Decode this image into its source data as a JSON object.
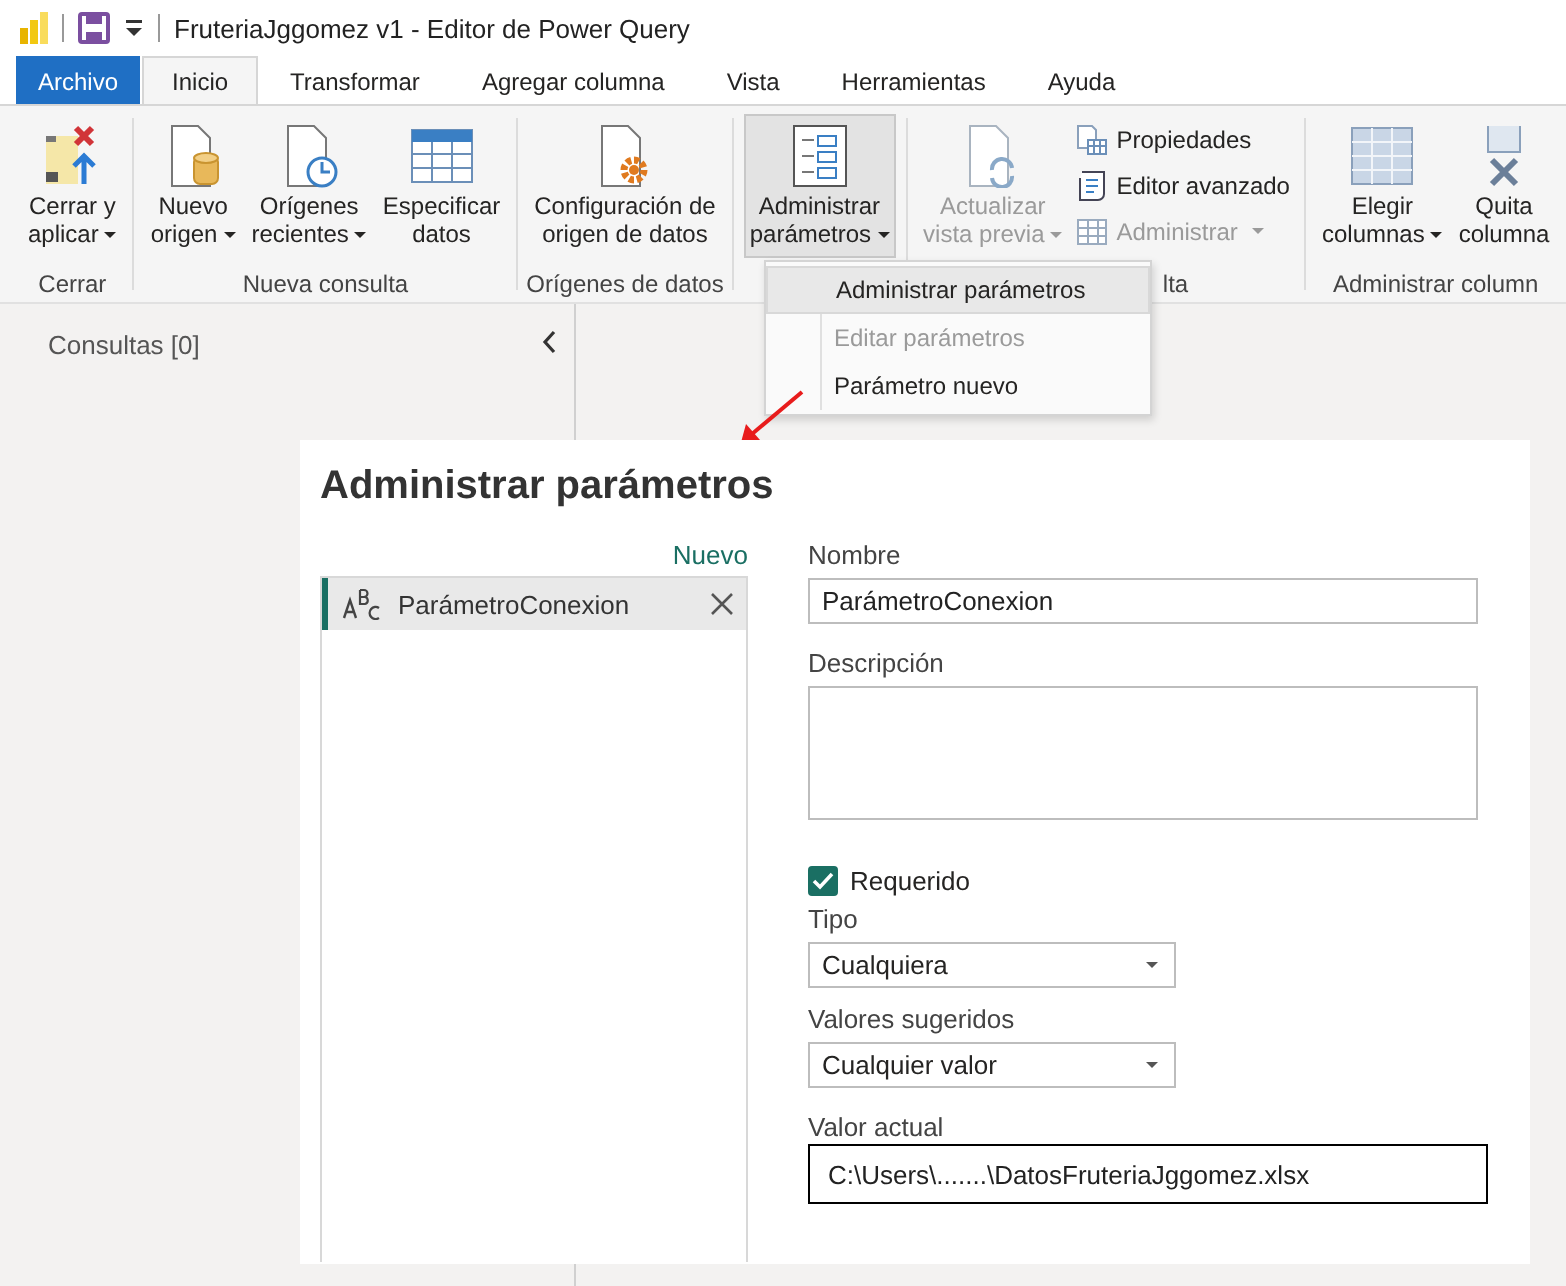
{
  "title_bar": {
    "title": "FruteriaJggomez v1 - Editor de Power Query"
  },
  "tabs": [
    {
      "label": "Archivo",
      "kind": "file",
      "selected": false
    },
    {
      "label": "Inicio",
      "kind": "tab",
      "selected": true
    },
    {
      "label": "Transformar",
      "kind": "tab",
      "selected": false
    },
    {
      "label": "Agregar columna",
      "kind": "tab",
      "selected": false
    },
    {
      "label": "Vista",
      "kind": "tab",
      "selected": false
    },
    {
      "label": "Herramientas",
      "kind": "tab",
      "selected": false
    },
    {
      "label": "Ayuda",
      "kind": "tab",
      "selected": false
    }
  ],
  "ribbon": {
    "groups": [
      {
        "label": "Cerrar",
        "items": [
          {
            "kind": "large",
            "lines": [
              "Cerrar y",
              "aplicar"
            ],
            "dropdown": true,
            "disabled": false,
            "pressed": false
          }
        ]
      },
      {
        "label": "Nueva consulta",
        "items": [
          {
            "kind": "large",
            "lines": [
              "Nuevo",
              "origen"
            ],
            "dropdown": true,
            "disabled": false,
            "pressed": false
          },
          {
            "kind": "large",
            "lines": [
              "Orígenes",
              "recientes"
            ],
            "dropdown": true,
            "disabled": false,
            "pressed": false
          },
          {
            "kind": "large",
            "lines": [
              "Especificar",
              "datos"
            ],
            "dropdown": false,
            "disabled": false,
            "pressed": false
          }
        ]
      },
      {
        "label": "Orígenes de datos",
        "items": [
          {
            "kind": "large",
            "lines": [
              "Configuración de",
              "origen de datos"
            ],
            "dropdown": false,
            "disabled": false,
            "pressed": false
          }
        ]
      },
      {
        "items": [
          {
            "kind": "large",
            "lines": [
              "Administrar",
              "parámetros"
            ],
            "dropdown": true,
            "disabled": false,
            "pressed": true
          }
        ]
      },
      {
        "label": "lta",
        "items": [
          {
            "kind": "large",
            "lines": [
              "Actualizar",
              "vista previa"
            ],
            "dropdown": true,
            "disabled": true,
            "pressed": false
          },
          {
            "kind": "small",
            "lines": [
              "Propiedades"
            ],
            "dropdown": false,
            "disabled": false
          },
          {
            "kind": "small",
            "lines": [
              "Editor avanzado"
            ],
            "dropdown": false,
            "disabled": false
          },
          {
            "kind": "small",
            "lines": [
              "Administrar"
            ],
            "dropdown": true,
            "disabled": true
          }
        ]
      },
      {
        "label": "Administrar column",
        "items": [
          {
            "kind": "large",
            "lines": [
              "Elegir",
              "columnas"
            ],
            "dropdown": true,
            "disabled": false,
            "pressed": false
          },
          {
            "kind": "large",
            "lines": [
              "Quita",
              "columna"
            ],
            "dropdown": false,
            "disabled": false,
            "pressed": false
          }
        ]
      }
    ]
  },
  "query_pane": {
    "title": "Consultas [0]"
  },
  "menu": {
    "items": [
      {
        "label": "Administrar parámetros",
        "selected": true,
        "disabled": false
      },
      {
        "label": "Editar parámetros",
        "selected": false,
        "disabled": true
      },
      {
        "label": "Parámetro nuevo",
        "selected": false,
        "disabled": false
      }
    ]
  },
  "dialog": {
    "title": "Administrar parámetros",
    "new_link": "Nuevo",
    "parameters": [
      {
        "name": "ParámetroConexion",
        "selected": true
      }
    ],
    "form": {
      "name_label": "Nombre",
      "name_value": "ParámetroConexion",
      "description_label": "Descripción",
      "required": {
        "label": "Requerido",
        "checked": true
      },
      "type_label": "Tipo",
      "type_value": "Cualquiera",
      "suggested_label": "Valores sugeridos",
      "suggested_value": "Cualquier valor",
      "current_label": "Valor actual",
      "current_value": "C:\\Users\\.......\\DatosFruteriaJggomez.xlsx"
    }
  }
}
